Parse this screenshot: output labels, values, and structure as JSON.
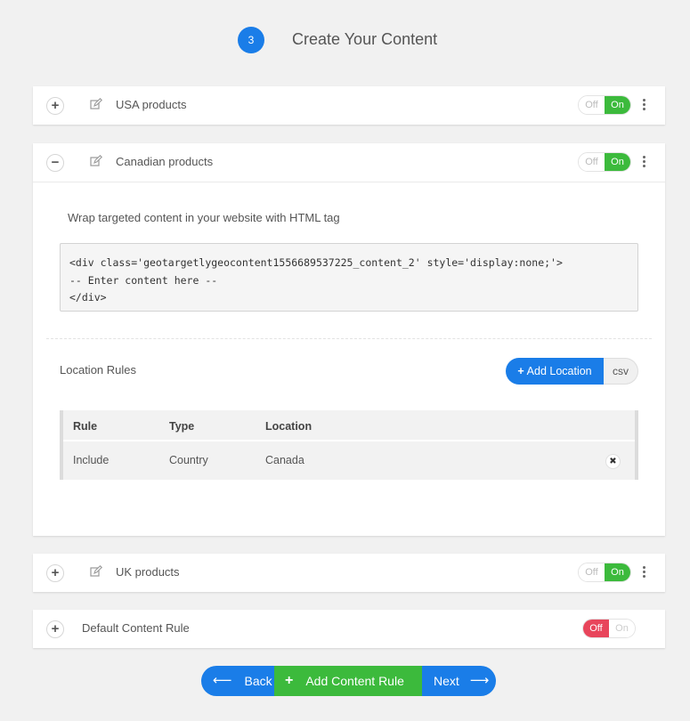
{
  "step": {
    "number": "3",
    "title": "Create Your Content"
  },
  "rules": [
    {
      "title": "USA products",
      "off_label": "Off",
      "on_label": "On",
      "state": "on",
      "expanded": false
    },
    {
      "title": "Canadian products",
      "off_label": "Off",
      "on_label": "On",
      "state": "on",
      "expanded": true
    },
    {
      "title": "UK products",
      "off_label": "Off",
      "on_label": "On",
      "state": "on",
      "expanded": false
    },
    {
      "title": "Default Content Rule",
      "off_label": "Off",
      "on_label": "On",
      "state": "off",
      "expanded": false
    }
  ],
  "expanded_panel": {
    "wrap_text": "Wrap targeted content in your website with HTML tag",
    "code_line1": "<div class='geotargetlygeocontent1556689537225_content_2' style='display:none;'>",
    "code_line2": "-- Enter content here --",
    "code_line3": "</div>",
    "location_rules_label": "Location Rules",
    "add_location_label": "Add Location",
    "csv_label": "csv",
    "table": {
      "headers": [
        "Rule",
        "Type",
        "Location"
      ],
      "rows": [
        {
          "rule": "Include",
          "type": "Country",
          "location": "Canada"
        }
      ]
    }
  },
  "actions": {
    "back_label": "Back",
    "add_rule_label": "Add Content Rule",
    "next_label": "Next"
  },
  "colors": {
    "primary": "#1a7de8",
    "success": "#3cba3c",
    "danger": "#e8455b"
  },
  "icons": {
    "expand": "plus-circle-icon",
    "collapse": "minus-circle-icon",
    "edit": "edit-icon",
    "menu": "kebab-menu-icon",
    "remove": "close-icon",
    "back": "arrow-left-icon",
    "next": "arrow-right-icon"
  }
}
